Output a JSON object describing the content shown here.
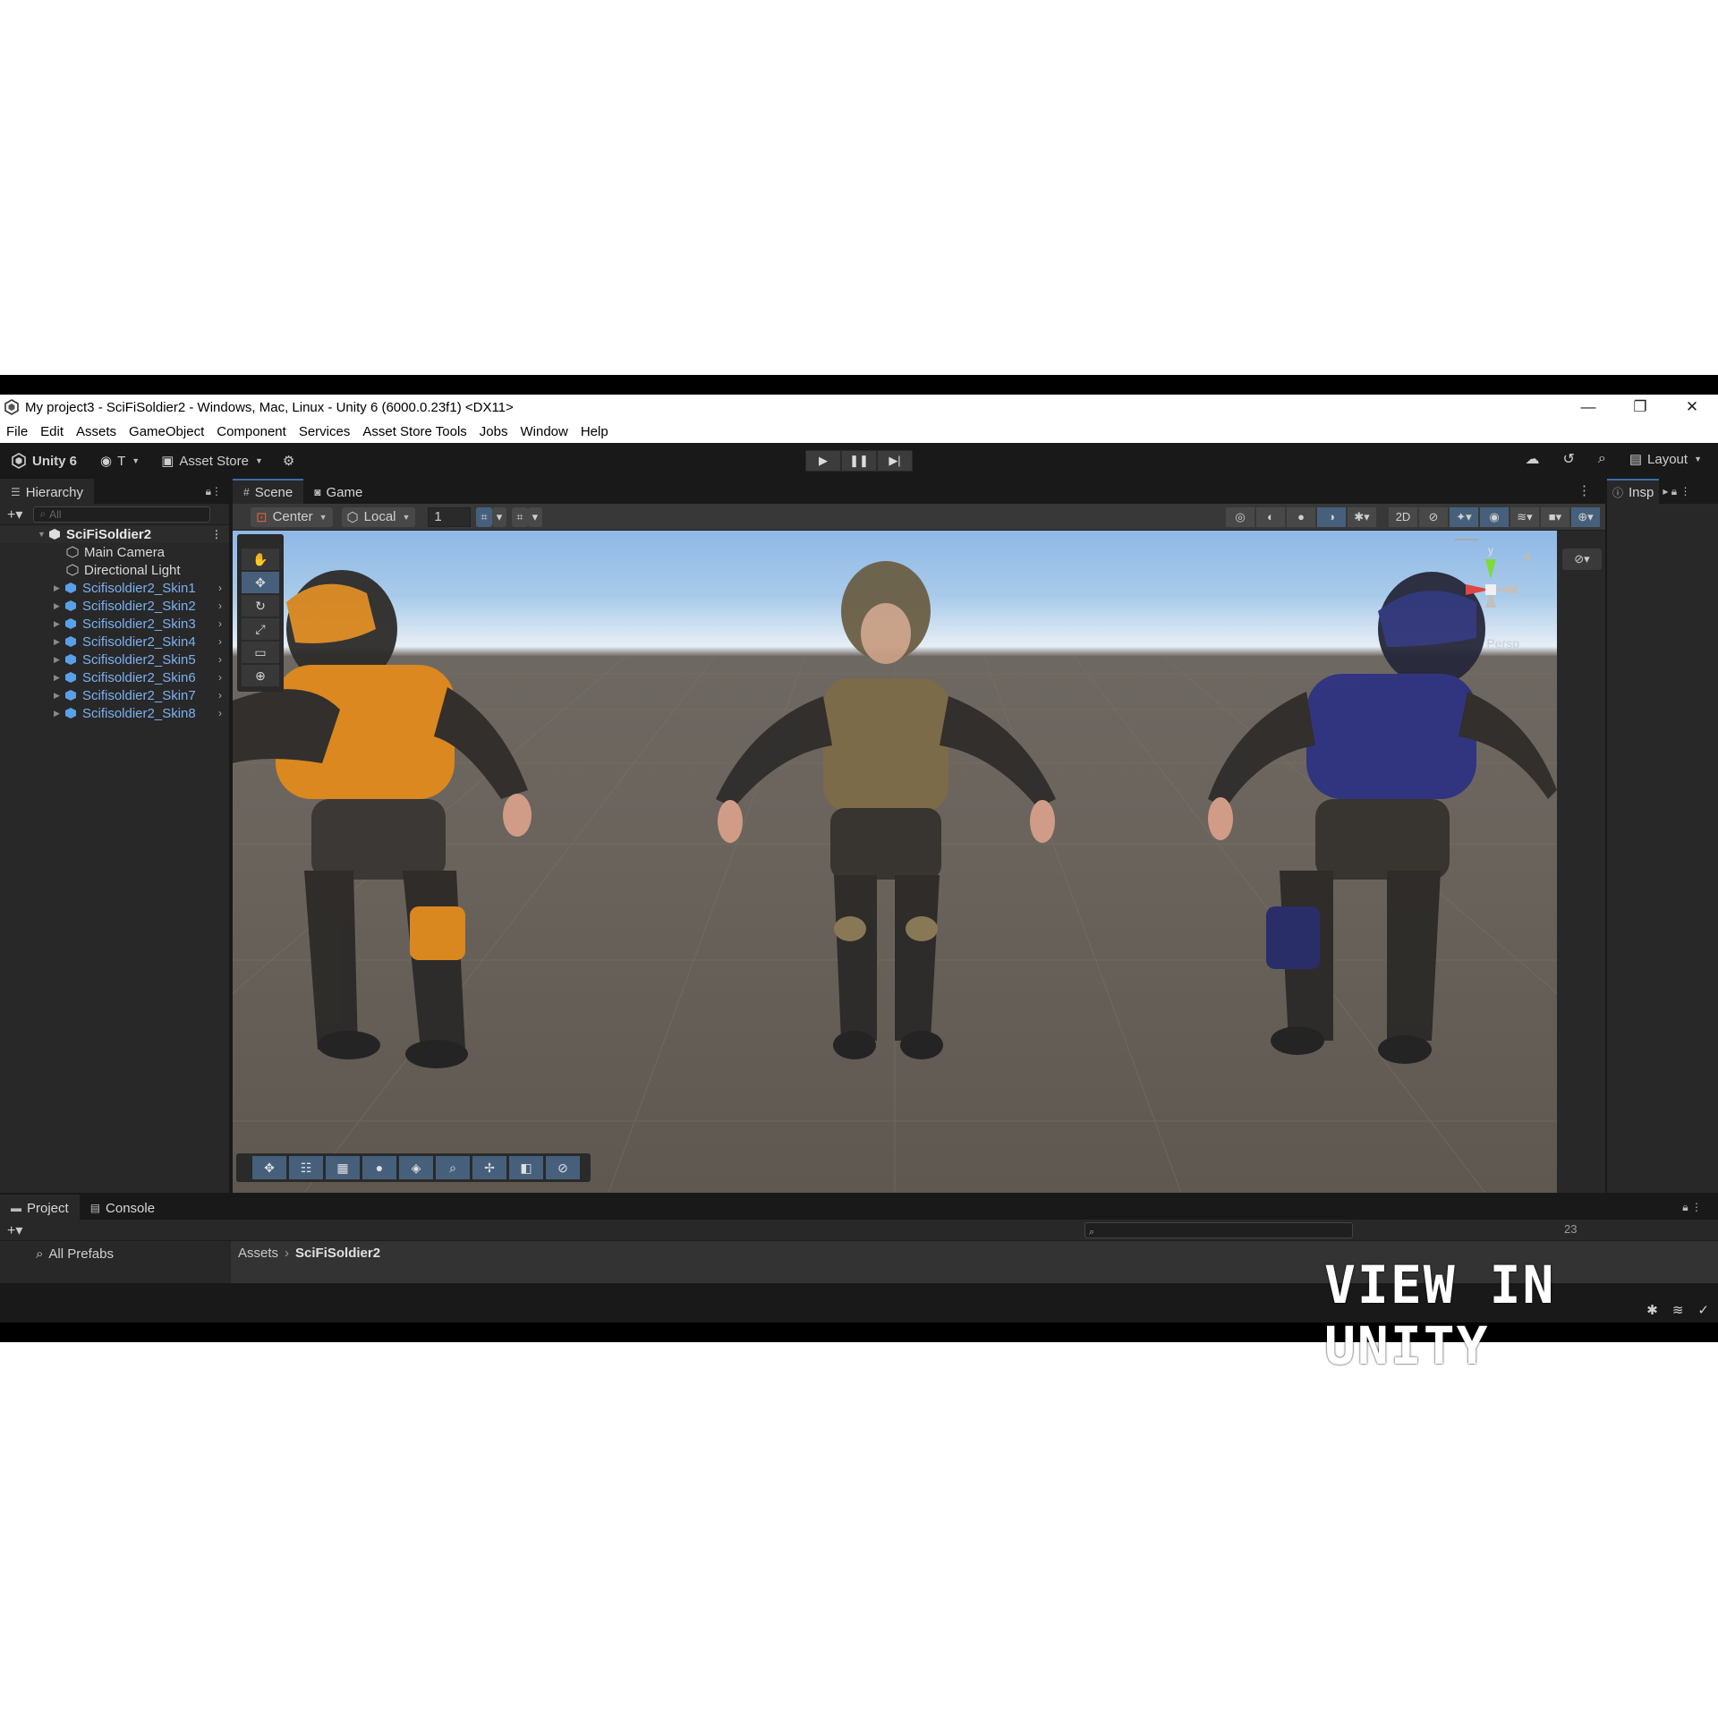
{
  "window": {
    "title": "My project3 - SciFiSoldier2 - Windows, Mac, Linux - Unity 6 (6000.0.23f1) <DX11>",
    "controls": [
      "—",
      "❐",
      "✕"
    ]
  },
  "menu": [
    "File",
    "Edit",
    "Assets",
    "GameObject",
    "Component",
    "Services",
    "Asset Store Tools",
    "Jobs",
    "Window",
    "Help"
  ],
  "toolbar": {
    "unity_label": "Unity 6",
    "account_label": "T",
    "asset_store_label": "Asset Store",
    "layout_label": "Layout"
  },
  "hierarchy": {
    "tab_label": "Hierarchy",
    "search_placeholder": "All",
    "root": "SciFiSoldier2",
    "items": [
      {
        "label": "Main Camera",
        "type": "object"
      },
      {
        "label": "Directional Light",
        "type": "object"
      },
      {
        "label": "Scifisoldier2_Skin1",
        "type": "prefab"
      },
      {
        "label": "Scifisoldier2_Skin2",
        "type": "prefab"
      },
      {
        "label": "Scifisoldier2_Skin3",
        "type": "prefab"
      },
      {
        "label": "Scifisoldier2_Skin4",
        "type": "prefab"
      },
      {
        "label": "Scifisoldier2_Skin5",
        "type": "prefab"
      },
      {
        "label": "Scifisoldier2_Skin6",
        "type": "prefab"
      },
      {
        "label": "Scifisoldier2_Skin7",
        "type": "prefab"
      },
      {
        "label": "Scifisoldier2_Skin8",
        "type": "prefab"
      }
    ]
  },
  "scene": {
    "tabs": [
      "Scene",
      "Game"
    ],
    "pivot_label": "Center",
    "space_label": "Local",
    "grid_snap_value": "1",
    "camera_mode": "Persp",
    "gizmo_axis": "y"
  },
  "inspector": {
    "tab_label": "Insp"
  },
  "project": {
    "tabs": [
      "Project",
      "Console"
    ],
    "favorites_label": "All Prefabs",
    "breadcrumb_root": "Assets",
    "breadcrumb_current": "SciFiSoldier2",
    "count": "23"
  },
  "watermark": "VIEW IN UNITY",
  "colors": {
    "accent_blue": "#46607c",
    "prefab_text": "#7cb0f0",
    "editor_bg": "#282828"
  }
}
